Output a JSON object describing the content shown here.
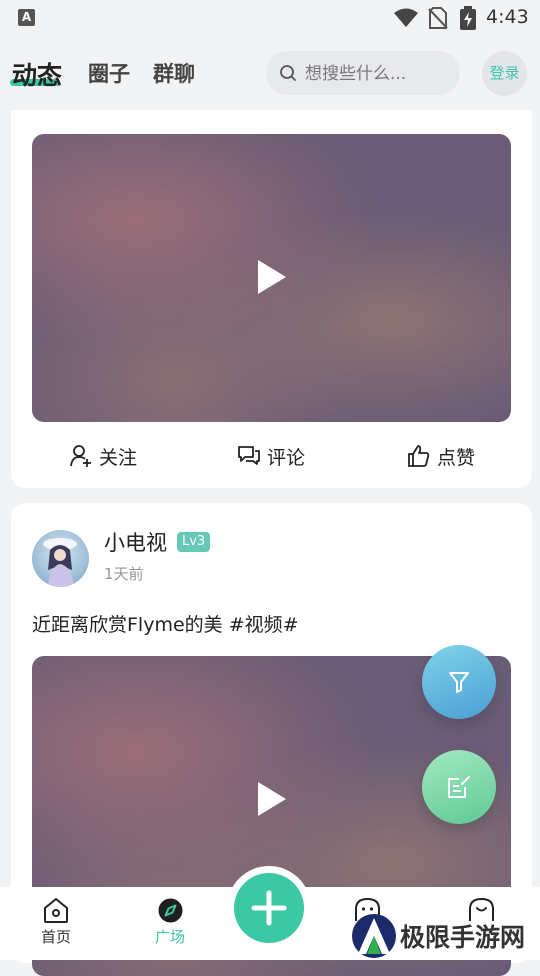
{
  "status_bar": {
    "app_icon_letter": "A",
    "time": "4:43",
    "icons": [
      "wifi-icon",
      "no-sim-icon",
      "battery-charging-icon"
    ]
  },
  "header": {
    "tabs": [
      {
        "label": "动态",
        "active": true
      },
      {
        "label": "圈子",
        "active": false
      },
      {
        "label": "群聊",
        "active": false
      }
    ],
    "search": {
      "placeholder": "想搜些什么..."
    },
    "login_label": "登录",
    "accent_color": "#3cc7a5"
  },
  "feed": [
    {
      "type": "video",
      "actions": {
        "follow": "关注",
        "comment": "评论",
        "like": "点赞"
      }
    },
    {
      "type": "video",
      "username": "小电视",
      "level": "Lv3",
      "time": "1天前",
      "text": "近距离欣赏Flyme的美 #视频#"
    }
  ],
  "fabs": [
    "filter-icon",
    "edit-icon"
  ],
  "bottom_nav": {
    "items": [
      {
        "label": "首页",
        "icon": "home-icon",
        "active": false
      },
      {
        "label": "广场",
        "icon": "compass-icon",
        "active": true
      },
      {
        "label": "",
        "icon": "plus-icon",
        "active": false
      },
      {
        "label": "",
        "icon": "message-icon",
        "active": false
      },
      {
        "label": "",
        "icon": "user-icon",
        "active": false
      }
    ]
  },
  "watermark": {
    "text": "极限手游网"
  }
}
